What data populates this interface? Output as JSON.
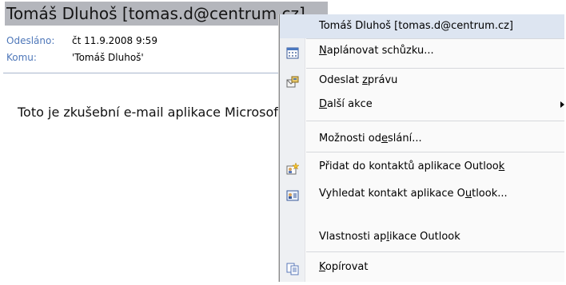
{
  "email": {
    "sender_line": "Tomáš Dluhoš [tomas.d@centrum.cz]",
    "sent_label": "Odesláno:",
    "sent_value": "čt 11.9.2008 9:59",
    "to_label": "Komu:",
    "to_value": "'Tomáš Dluhoš'",
    "body": "Toto je zkušební e-mail aplikace Microsoft Outlook"
  },
  "context_menu": {
    "items": [
      {
        "label": "Tomáš Dluhoš [tomas.d@centrum.cz]",
        "icon": null
      },
      {
        "label_pre": "",
        "label_ul": "N",
        "label_post": "aplánovat schůzku...",
        "icon": "calendar-icon"
      },
      {
        "label_pre": "Odeslat ",
        "label_ul": "z",
        "label_post": "právu",
        "icon": "send-message-icon"
      },
      {
        "label_pre": "",
        "label_ul": "D",
        "label_post": "alší akce",
        "icon": null,
        "submenu": true
      },
      {
        "label_pre": "Možnosti od",
        "label_ul": "e",
        "label_post": "slání...",
        "icon": null
      },
      {
        "label_pre": "Přidat do kontaktů aplikace Outloo",
        "label_ul": "k",
        "label_post": "",
        "icon": "add-contact-icon"
      },
      {
        "label_pre": "Vyhledat kontakt aplikace O",
        "label_ul": "u",
        "label_post": "tlook...",
        "icon": "contact-card-icon"
      },
      {
        "label_pre": "Vlastnosti ap",
        "label_ul": "l",
        "label_post": "ikace Outlook",
        "icon": null
      },
      {
        "label_pre": "",
        "label_ul": "K",
        "label_post": "opírovat",
        "icon": "copy-icon"
      }
    ]
  },
  "colors": {
    "header_highlight": "#b4b6bc",
    "label_blue": "#4e77b9",
    "menu_gutter": "#eef0f3",
    "menu_hover": "#dde5f1"
  }
}
